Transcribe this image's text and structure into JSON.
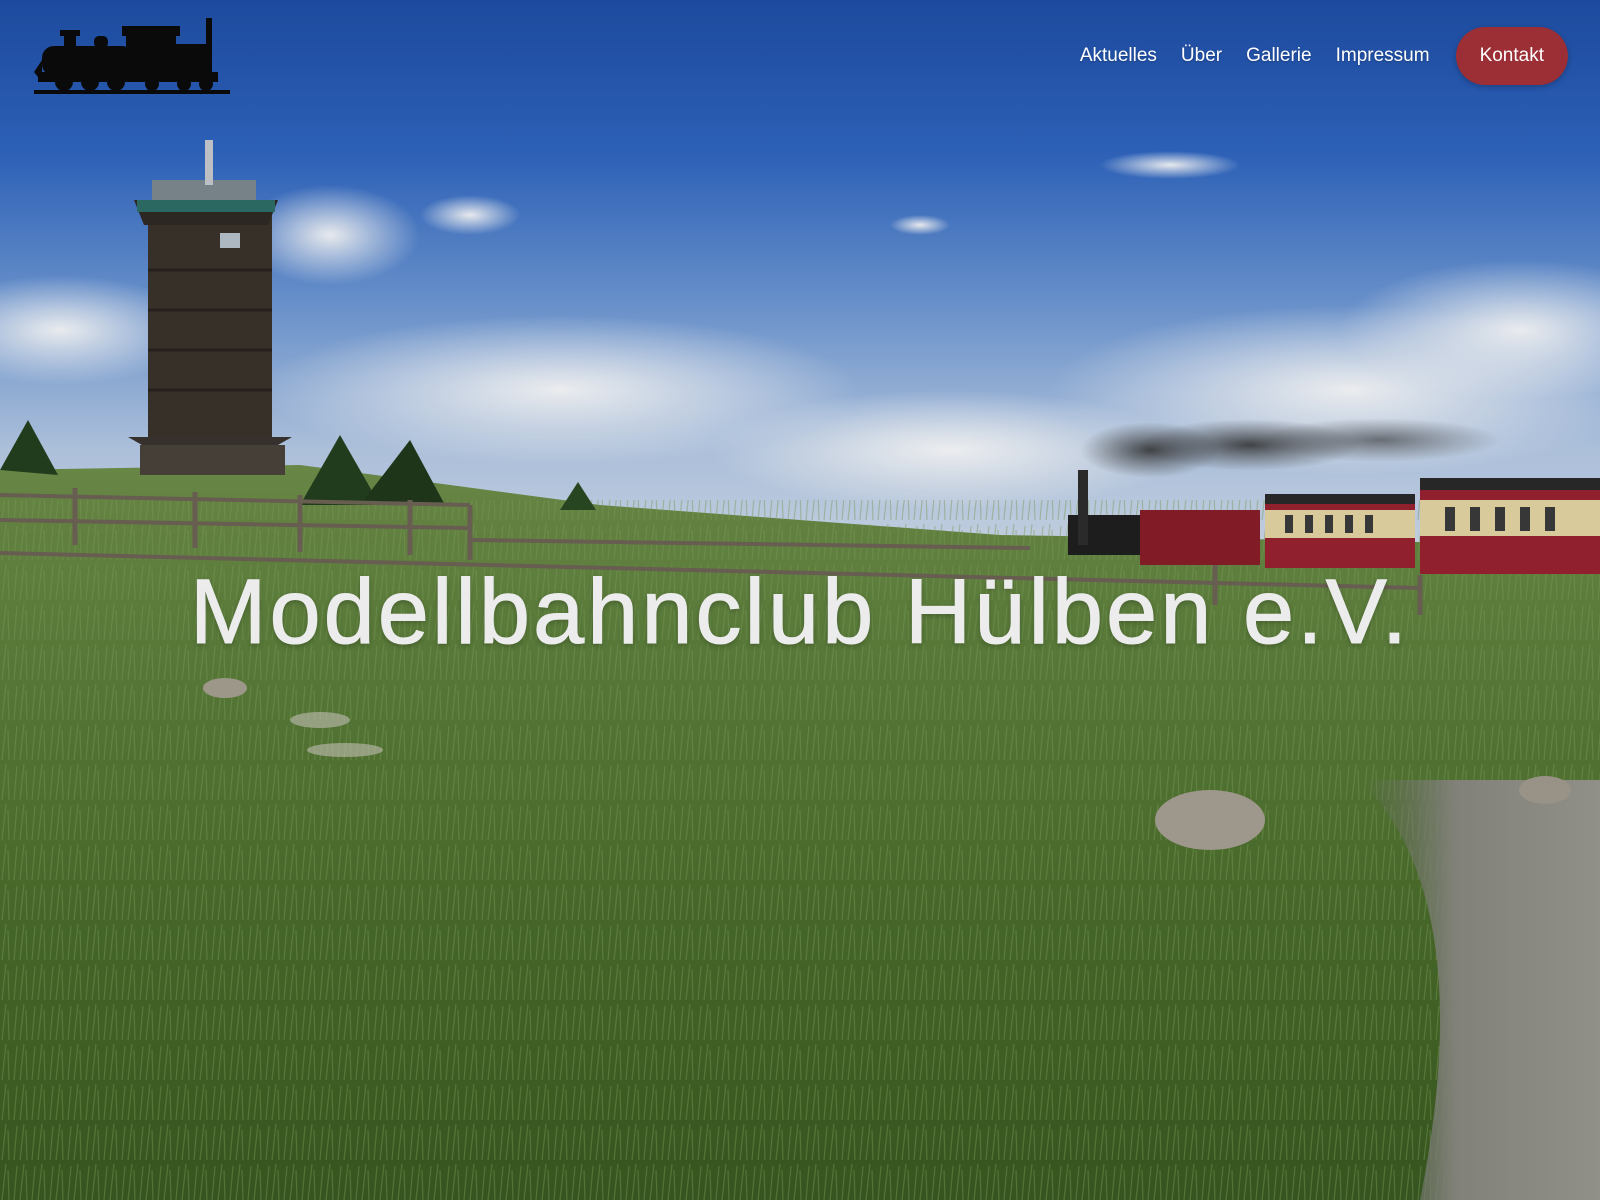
{
  "site": {
    "logo_icon": "steam-locomotive-icon",
    "hero_title": "Modellbahnclub Hülben e.V."
  },
  "nav": {
    "items": [
      {
        "label": "Aktuelles"
      },
      {
        "label": "Über"
      },
      {
        "label": "Gallerie"
      },
      {
        "label": "Impressum"
      }
    ],
    "cta_label": "Kontakt"
  },
  "colors": {
    "cta_background": "#9b2f35",
    "nav_text": "#ffffff",
    "title_text": "#ececec"
  }
}
